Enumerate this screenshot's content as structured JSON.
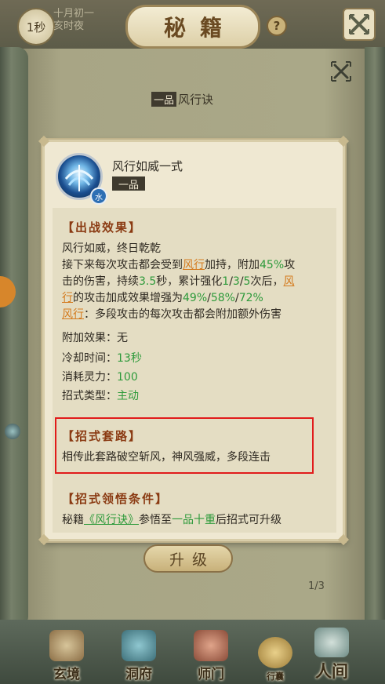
{
  "top_bar": {
    "timer": "1秒",
    "date_line1": "十月初一",
    "date_line2": "亥时夜",
    "title": "秘籍",
    "help": "?"
  },
  "book_tab": {
    "grade": "一品",
    "name": "风行诀"
  },
  "skill": {
    "name": "风行如威一式",
    "grade": "一品",
    "element": "水",
    "icon": "wind-swirl-icon"
  },
  "battle_effect": {
    "title": "【出战效果】",
    "line1": "风行如威，终日乾乾",
    "line2_a": "接下来每次攻击都会受到",
    "line2_link": "风行",
    "line2_b": "加持，附加",
    "line2_val": "45%",
    "line2_c": "攻",
    "line3_a": "击的伤害，持续",
    "line3_val": "3.5",
    "line3_b": "秒，累计强化",
    "line3_s1": "1",
    "line3_sep1": "/",
    "line3_s2": "3",
    "line3_sep2": "/",
    "line3_s3": "5",
    "line3_c": "次后，",
    "line3_link": "风",
    "line4_link": "行",
    "line4_a": "的攻击加成效果增强为",
    "line4_v1": "49%",
    "line4_sep1": "/",
    "line4_v2": "58%",
    "line4_sep2": "/",
    "line4_v3": "72%",
    "line5_link": "风行",
    "line5_a": "：多段攻击的每次攻击都会附加额外伤害"
  },
  "stats": {
    "extra_label": "附加效果：",
    "extra_value": "无",
    "cooldown_label": "冷却时间：",
    "cooldown_value": "13秒",
    "cost_label": "消耗灵力：",
    "cost_value": "100",
    "type_label": "招式类型：",
    "type_value": "主动"
  },
  "routine": {
    "title": "【招式套路】",
    "text": "相传此套路破空斩风，神风强威，多段连击"
  },
  "condition": {
    "title": "【招式领悟条件】",
    "a": "秘籍",
    "link": "《风行诀》",
    "b": "参悟至",
    "value": "一品十重",
    "c": "后招式可升级"
  },
  "upgrade_label": "升级",
  "page_indicator": "1/3",
  "bottom_nav": {
    "items": [
      {
        "label": "玄境"
      },
      {
        "label": "洞府"
      },
      {
        "label": "师门"
      },
      {
        "label": "行囊"
      },
      {
        "label": "人间"
      }
    ]
  },
  "colors": {
    "accent_title": "#8a3a12",
    "green_value": "#2e9a3b",
    "orange_link": "#d47a1d",
    "highlight_box": "#e11b1b"
  }
}
